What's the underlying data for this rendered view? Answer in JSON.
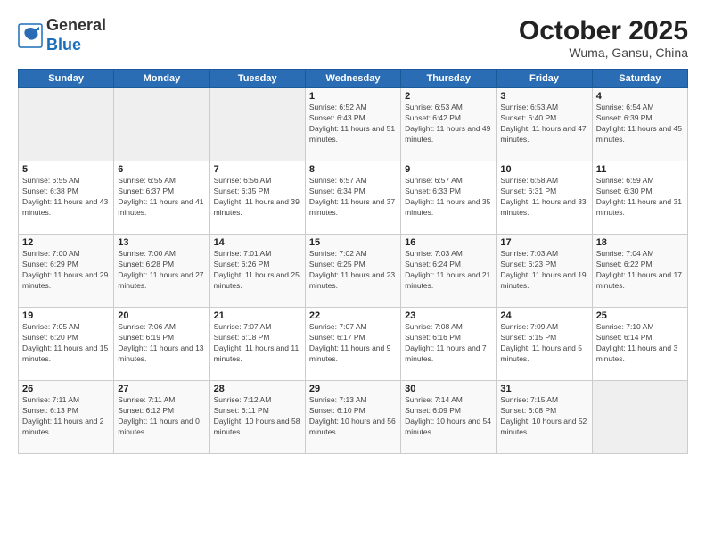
{
  "header": {
    "logo_general": "General",
    "logo_blue": "Blue",
    "title": "October 2025",
    "subtitle": "Wuma, Gansu, China"
  },
  "weekdays": [
    "Sunday",
    "Monday",
    "Tuesday",
    "Wednesday",
    "Thursday",
    "Friday",
    "Saturday"
  ],
  "weeks": [
    [
      {
        "day": "",
        "empty": true
      },
      {
        "day": "",
        "empty": true
      },
      {
        "day": "",
        "empty": true
      },
      {
        "day": "1",
        "sunrise": "6:52 AM",
        "sunset": "6:43 PM",
        "daylight": "11 hours and 51 minutes."
      },
      {
        "day": "2",
        "sunrise": "6:53 AM",
        "sunset": "6:42 PM",
        "daylight": "11 hours and 49 minutes."
      },
      {
        "day": "3",
        "sunrise": "6:53 AM",
        "sunset": "6:40 PM",
        "daylight": "11 hours and 47 minutes."
      },
      {
        "day": "4",
        "sunrise": "6:54 AM",
        "sunset": "6:39 PM",
        "daylight": "11 hours and 45 minutes."
      }
    ],
    [
      {
        "day": "5",
        "sunrise": "6:55 AM",
        "sunset": "6:38 PM",
        "daylight": "11 hours and 43 minutes."
      },
      {
        "day": "6",
        "sunrise": "6:55 AM",
        "sunset": "6:37 PM",
        "daylight": "11 hours and 41 minutes."
      },
      {
        "day": "7",
        "sunrise": "6:56 AM",
        "sunset": "6:35 PM",
        "daylight": "11 hours and 39 minutes."
      },
      {
        "day": "8",
        "sunrise": "6:57 AM",
        "sunset": "6:34 PM",
        "daylight": "11 hours and 37 minutes."
      },
      {
        "day": "9",
        "sunrise": "6:57 AM",
        "sunset": "6:33 PM",
        "daylight": "11 hours and 35 minutes."
      },
      {
        "day": "10",
        "sunrise": "6:58 AM",
        "sunset": "6:31 PM",
        "daylight": "11 hours and 33 minutes."
      },
      {
        "day": "11",
        "sunrise": "6:59 AM",
        "sunset": "6:30 PM",
        "daylight": "11 hours and 31 minutes."
      }
    ],
    [
      {
        "day": "12",
        "sunrise": "7:00 AM",
        "sunset": "6:29 PM",
        "daylight": "11 hours and 29 minutes."
      },
      {
        "day": "13",
        "sunrise": "7:00 AM",
        "sunset": "6:28 PM",
        "daylight": "11 hours and 27 minutes."
      },
      {
        "day": "14",
        "sunrise": "7:01 AM",
        "sunset": "6:26 PM",
        "daylight": "11 hours and 25 minutes."
      },
      {
        "day": "15",
        "sunrise": "7:02 AM",
        "sunset": "6:25 PM",
        "daylight": "11 hours and 23 minutes."
      },
      {
        "day": "16",
        "sunrise": "7:03 AM",
        "sunset": "6:24 PM",
        "daylight": "11 hours and 21 minutes."
      },
      {
        "day": "17",
        "sunrise": "7:03 AM",
        "sunset": "6:23 PM",
        "daylight": "11 hours and 19 minutes."
      },
      {
        "day": "18",
        "sunrise": "7:04 AM",
        "sunset": "6:22 PM",
        "daylight": "11 hours and 17 minutes."
      }
    ],
    [
      {
        "day": "19",
        "sunrise": "7:05 AM",
        "sunset": "6:20 PM",
        "daylight": "11 hours and 15 minutes."
      },
      {
        "day": "20",
        "sunrise": "7:06 AM",
        "sunset": "6:19 PM",
        "daylight": "11 hours and 13 minutes."
      },
      {
        "day": "21",
        "sunrise": "7:07 AM",
        "sunset": "6:18 PM",
        "daylight": "11 hours and 11 minutes."
      },
      {
        "day": "22",
        "sunrise": "7:07 AM",
        "sunset": "6:17 PM",
        "daylight": "11 hours and 9 minutes."
      },
      {
        "day": "23",
        "sunrise": "7:08 AM",
        "sunset": "6:16 PM",
        "daylight": "11 hours and 7 minutes."
      },
      {
        "day": "24",
        "sunrise": "7:09 AM",
        "sunset": "6:15 PM",
        "daylight": "11 hours and 5 minutes."
      },
      {
        "day": "25",
        "sunrise": "7:10 AM",
        "sunset": "6:14 PM",
        "daylight": "11 hours and 3 minutes."
      }
    ],
    [
      {
        "day": "26",
        "sunrise": "7:11 AM",
        "sunset": "6:13 PM",
        "daylight": "11 hours and 2 minutes."
      },
      {
        "day": "27",
        "sunrise": "7:11 AM",
        "sunset": "6:12 PM",
        "daylight": "11 hours and 0 minutes."
      },
      {
        "day": "28",
        "sunrise": "7:12 AM",
        "sunset": "6:11 PM",
        "daylight": "10 hours and 58 minutes."
      },
      {
        "day": "29",
        "sunrise": "7:13 AM",
        "sunset": "6:10 PM",
        "daylight": "10 hours and 56 minutes."
      },
      {
        "day": "30",
        "sunrise": "7:14 AM",
        "sunset": "6:09 PM",
        "daylight": "10 hours and 54 minutes."
      },
      {
        "day": "31",
        "sunrise": "7:15 AM",
        "sunset": "6:08 PM",
        "daylight": "10 hours and 52 minutes."
      },
      {
        "day": "",
        "empty": true
      }
    ]
  ]
}
